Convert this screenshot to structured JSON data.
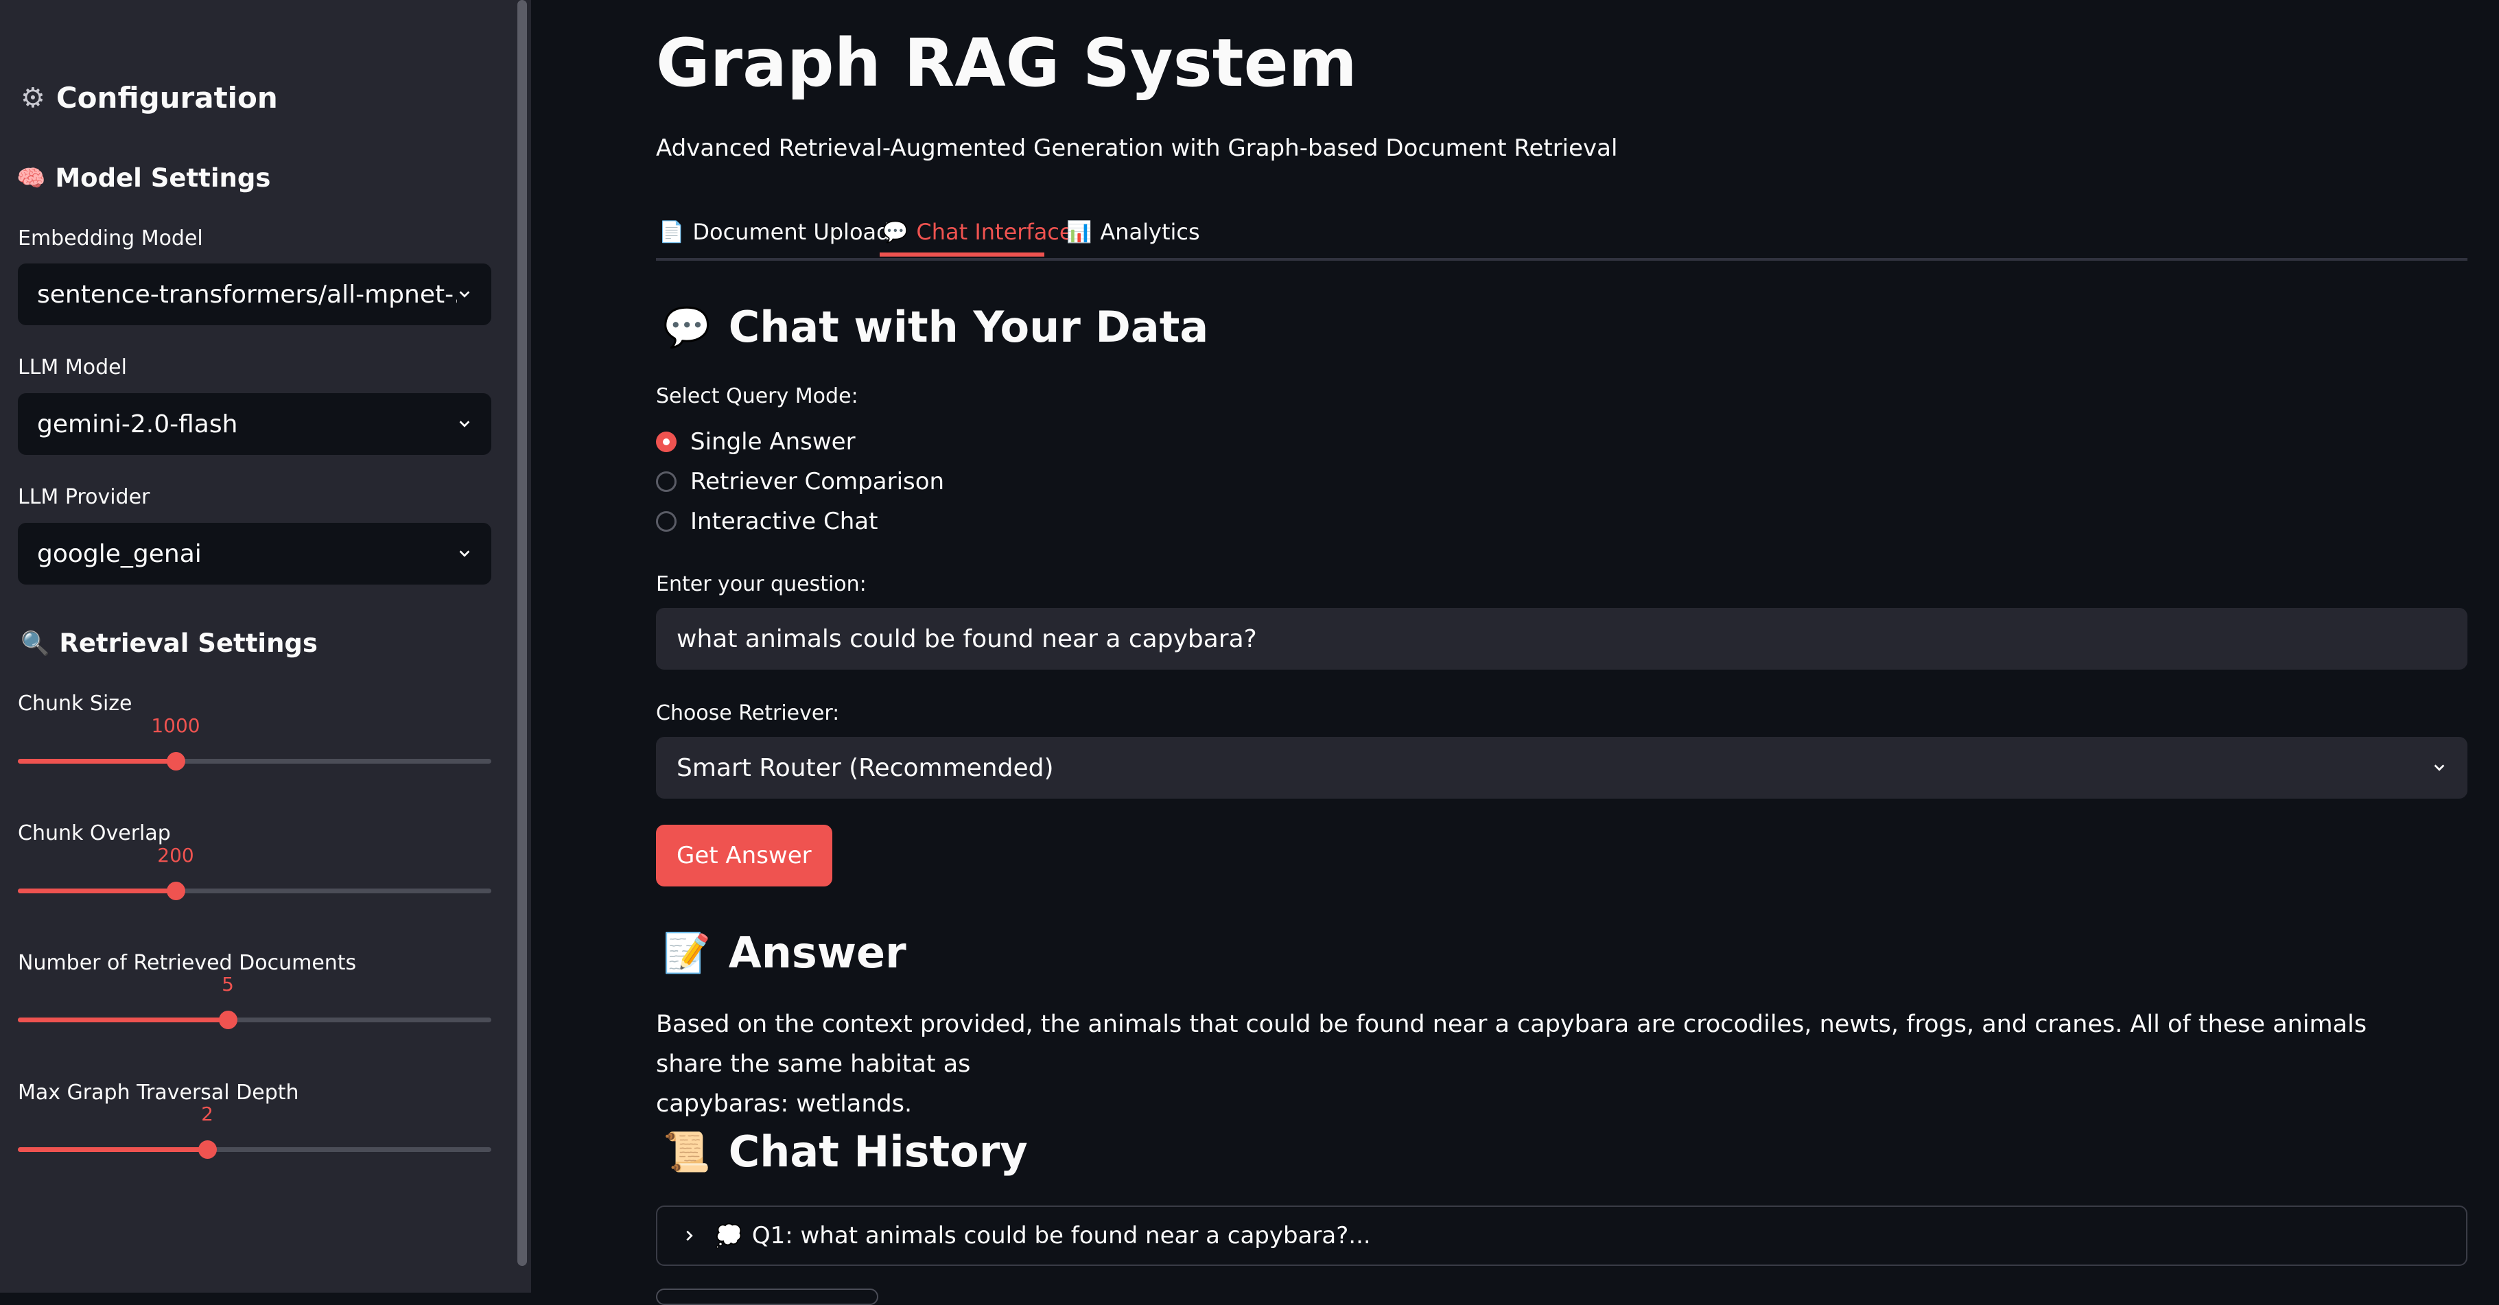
{
  "sidebar": {
    "header": {
      "icon": "gear-icon",
      "text": "Configuration"
    },
    "model_settings": {
      "icon": "brain-icon",
      "title": "Model Settings",
      "embedding_label": "Embedding Model",
      "embedding_value": "sentence-transformers/all-mpnet-…",
      "llm_label": "LLM Model",
      "llm_value": "gemini-2.0-flash",
      "provider_label": "LLM Provider",
      "provider_value": "google_genai"
    },
    "retrieval_settings": {
      "icon": "search-icon",
      "title": "Retrieval Settings",
      "sliders": [
        {
          "label": "Chunk Size",
          "value": "1000",
          "fraction": 0.333
        },
        {
          "label": "Chunk Overlap",
          "value": "200",
          "fraction": 0.333
        },
        {
          "label": "Number of Retrieved Documents",
          "value": "5",
          "fraction": 0.444
        },
        {
          "label": "Max Graph Traversal Depth",
          "value": "2",
          "fraction": 0.4
        }
      ]
    }
  },
  "main": {
    "title": "Graph RAG System",
    "subtitle": "Advanced Retrieval-Augmented Generation with Graph-based Document Retrieval",
    "tabs": [
      {
        "icon": "document-icon",
        "label": "Document Upload"
      },
      {
        "icon": "speech-bubble-icon",
        "label": "Chat Interface",
        "active": true
      },
      {
        "icon": "bar-chart-icon",
        "label": "Analytics"
      }
    ],
    "chat_header": {
      "icon": "speech-bubble-icon",
      "text": "Chat with Your Data"
    },
    "query_mode_label": "Select Query Mode:",
    "query_modes": [
      {
        "label": "Single Answer",
        "checked": true
      },
      {
        "label": "Retriever Comparison",
        "checked": false
      },
      {
        "label": "Interactive Chat",
        "checked": false
      }
    ],
    "question_label": "Enter your question:",
    "question_value": "what animals could be found near a capybara?",
    "retriever_label": "Choose Retriever:",
    "retriever_value": "Smart Router (Recommended)",
    "get_answer_button": "Get Answer",
    "answer_header": {
      "icon": "memo-icon",
      "text": "Answer"
    },
    "answer_line1": "Based on the context provided, the animals that could be found near a capybara are crocodiles, newts, frogs, and cranes. All of these animals share the same habitat as",
    "answer_line2": "capybaras: wetlands.",
    "history_header": {
      "icon": "scroll-icon",
      "text": "Chat History"
    },
    "history_items": [
      {
        "icon": "thought-bubble-icon",
        "label": "Q1: what animals could be found near a capybara?..."
      }
    ]
  },
  "colors": {
    "accent": "#ef5350",
    "background": "#0e1117",
    "sidebar": "#262730",
    "text": "#fafafa"
  }
}
